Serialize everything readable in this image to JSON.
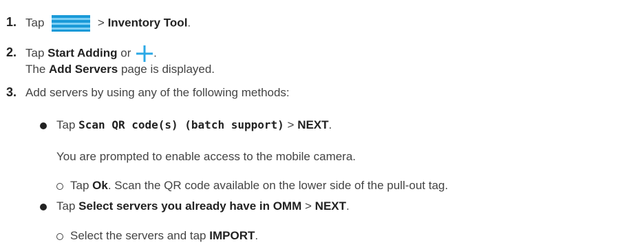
{
  "steps": {
    "s1": {
      "num": "1.",
      "pre": "Tap",
      "sep": ">",
      "bold": "Inventory Tool",
      "post": "."
    },
    "s2": {
      "num": "2.",
      "pre": "Tap",
      "bold1": "Start Adding",
      "mid": "or",
      "post": ".",
      "line2_pre": "The",
      "line2_bold": "Add Servers",
      "line2_post": "page is displayed."
    },
    "s3": {
      "num": "3.",
      "text": "Add servers by using any of the following methods:"
    }
  },
  "bullets": {
    "b1": {
      "pre": "Tap",
      "bold": "Scan QR code(s) (batch support)",
      "sep": ">",
      "bold2": "NEXT",
      "post": "."
    },
    "b1_note": "You are prompted to enable access to the mobile camera.",
    "b1_sub": {
      "pre": "Tap",
      "bold": "Ok",
      "post": ". Scan the QR code available on the lower side of the pull-out tag."
    },
    "b2": {
      "pre": "Tap",
      "bold": "Select servers you already have in OMM",
      "sep": ">",
      "bold2": "NEXT",
      "post": "."
    },
    "b2_sub": {
      "pre": "Select the servers and tap",
      "bold": "IMPORT",
      "post": "."
    }
  },
  "icons": {
    "menu": "hamburger-menu-icon",
    "add": "plus-icon"
  },
  "colors": {
    "icon_blue": "#1fa3e0",
    "text": "#444444",
    "bold": "#222222"
  }
}
